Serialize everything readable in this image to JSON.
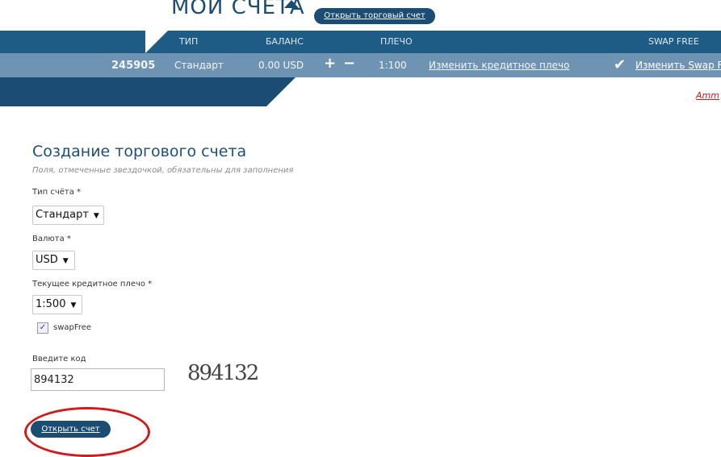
{
  "header": {
    "title": "МОИ СЧЕТА",
    "open_account_link": "Открыть торговый счет"
  },
  "table": {
    "columns": [
      "ТИП",
      "БАЛАНС",
      "ПЛЕЧО",
      "SWAP FREE"
    ],
    "row": {
      "account_number": "245905",
      "type": "Стандарт",
      "balance": "0.00 USD",
      "deposit_symbol": "+",
      "withdraw_symbol": "−",
      "leverage": "1:100",
      "change_leverage_link": "Изменить кредитное плечо",
      "swap_check_symbol": "✔",
      "change_swap_link": "Изменить Swap F"
    }
  },
  "band": {
    "red_link": "Amm"
  },
  "form": {
    "title": "Создание торгового счета",
    "subtitle": "Поля, отмеченные звездочкой, обязательны для заполнения",
    "account_type_label": "Тип счёта *",
    "account_type_value": "Стандарт",
    "currency_label": "Валюта *",
    "currency_value": "USD",
    "leverage_label": "Текущее кредитное плечо *",
    "leverage_value": "1:500",
    "swap_free_checked": true,
    "swap_free_check_mark": "✓",
    "swap_free_label": "swapFree",
    "code_label": "Введите код",
    "code_value": "894132",
    "captcha_text": "894132",
    "submit_label": "Открыть счет",
    "dropdown_arrow": "▼"
  },
  "colors": {
    "header_bg": "#1e5c86",
    "row_bg": "#6f93b2",
    "band_bg": "#1b4d74",
    "annotation": "#d01b1b"
  }
}
